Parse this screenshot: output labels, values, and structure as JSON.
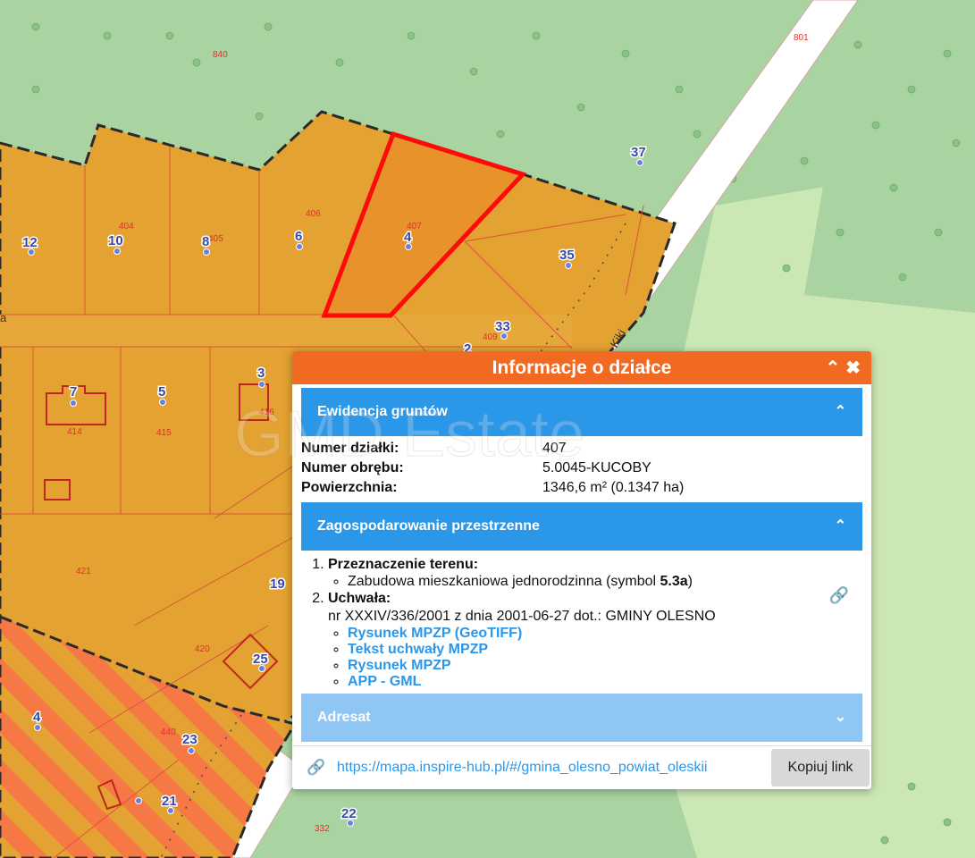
{
  "map": {
    "parcel_numbers": [
      "840",
      "801",
      "404",
      "405",
      "406",
      "407",
      "409",
      "414",
      "415",
      "416",
      "421",
      "420",
      "440",
      "332"
    ],
    "address_numbers": [
      "37",
      "12",
      "10",
      "8",
      "6",
      "4",
      "35",
      "33",
      "2",
      "7",
      "5",
      "3",
      "19",
      "25",
      "4",
      "23",
      "21",
      "22"
    ],
    "street_labels": [
      "Kiki",
      "a"
    ],
    "selected_parcel_color": "#ff0a0a",
    "zone_color": "#e3a232",
    "forest_color": "#a9d4a2"
  },
  "popup": {
    "title": "Informacje o działce",
    "header_icons": [
      "collapse-icon",
      "close-icon"
    ],
    "sections": {
      "ewidencja": {
        "title": "Ewidencja gruntów",
        "rows": [
          {
            "label": "Numer działki:",
            "value": "407"
          },
          {
            "label": "Numer obrębu:",
            "value": "5.0045-KUCOBY"
          },
          {
            "label": "Powierzchnia:",
            "value": "1346,6 m² (0.1347 ha)"
          }
        ]
      },
      "zagospodarowanie": {
        "title": "Zagospodarowanie przestrzenne",
        "item1_title": "Przeznaczenie terenu:",
        "item1_text": "Zabudowa mieszkaniowa jednorodzinna (symbol ",
        "item1_symbol": "5.3a",
        "item1_close": ")",
        "item2_title": "Uchwała:",
        "item2_text": "nr XXXIV/336/2001 z dnia 2001-06-27 dot.: GMINY OLESNO",
        "links": [
          "Rysunek MPZP (GeoTIFF)",
          "Tekst uchwały MPZP",
          "Rysunek MPZP",
          "APP - GML"
        ]
      },
      "adresat": {
        "title": "Adresat"
      }
    },
    "footer": {
      "url": "https://mapa.inspire-hub.pl/#/gmina_olesno_powiat_oleskii",
      "copy_label": "Kopiuj link"
    },
    "watermark": "GMD Estate"
  }
}
